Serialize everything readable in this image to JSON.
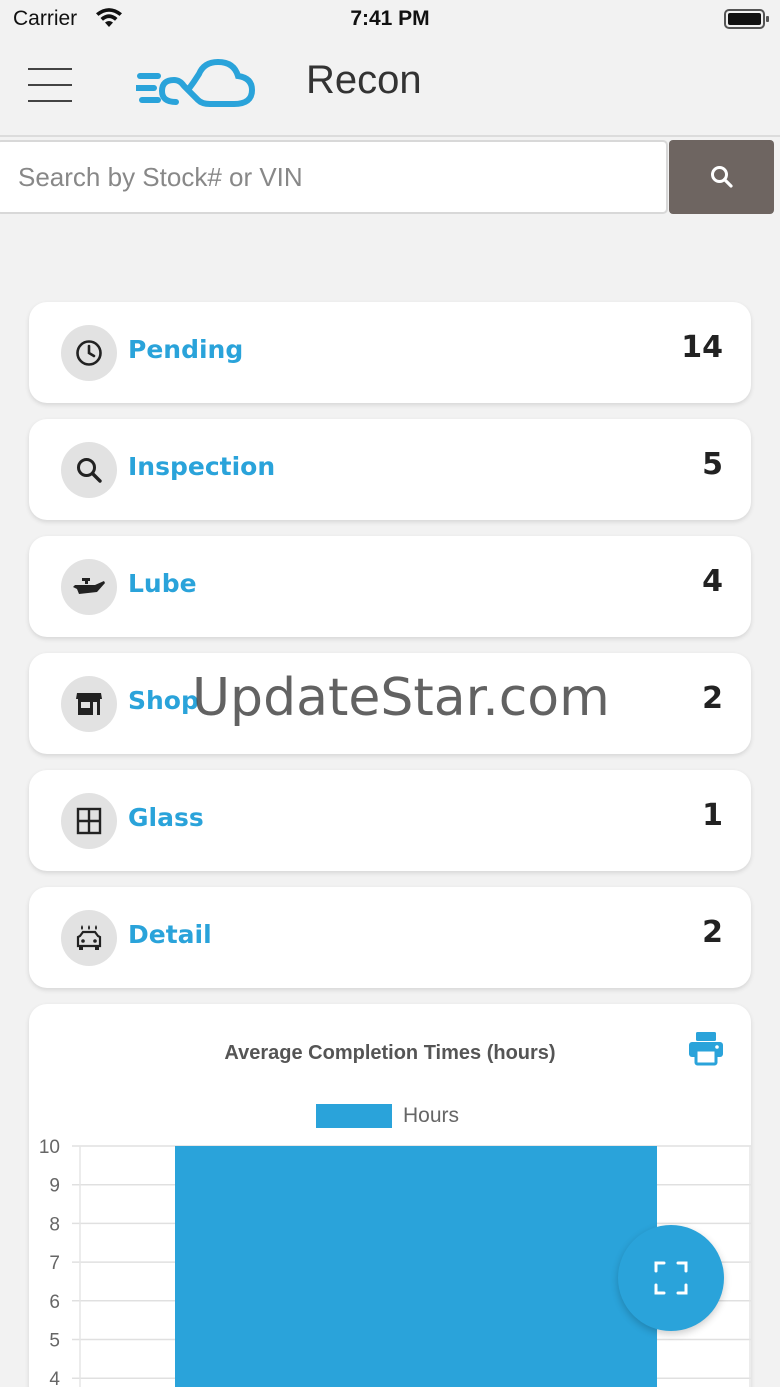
{
  "status_bar": {
    "carrier": "Carrier",
    "time": "7:41 PM"
  },
  "header": {
    "title": "Recon",
    "logo_icon": "cloud-logo-icon",
    "menu_icon": "hamburger-icon"
  },
  "search": {
    "placeholder": "Search by Stock# or VIN",
    "value": "",
    "button_icon": "search-icon"
  },
  "stages": [
    {
      "label": "Pending",
      "count": "14",
      "icon": "clock-icon"
    },
    {
      "label": "Inspection",
      "count": "5",
      "icon": "search-icon"
    },
    {
      "label": "Lube",
      "count": "4",
      "icon": "oil-can-icon"
    },
    {
      "label": "Shop",
      "count": "2",
      "icon": "storefront-icon"
    },
    {
      "label": "Glass",
      "count": "1",
      "icon": "window-icon"
    },
    {
      "label": "Detail",
      "count": "2",
      "icon": "car-wash-icon"
    }
  ],
  "watermark": "UpdateStar.com",
  "colors": {
    "accent": "#2aa3da",
    "search_button": "#6e6561",
    "background": "#f2f2f2"
  },
  "chart_data": {
    "type": "bar",
    "title": "Average Completion Times (hours)",
    "legend": [
      "Hours"
    ],
    "series": [
      {
        "name": "Hours",
        "values": [
          10
        ]
      }
    ],
    "y_ticks": [
      "10",
      "9",
      "8",
      "7",
      "6",
      "5",
      "4"
    ],
    "ylim_visible": [
      4,
      10
    ],
    "grid": true,
    "legend_position": "top"
  },
  "fab": {
    "icon": "scan-frame-icon"
  }
}
